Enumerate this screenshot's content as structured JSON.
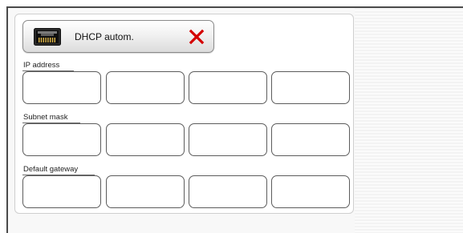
{
  "network": {
    "dhcp_button": {
      "label": "DHCP autom.",
      "icon": "ethernet-port-icon",
      "close_icon": "close-icon",
      "close_color": "#d40000"
    },
    "sections": [
      {
        "label": "IP address",
        "octets": [
          "",
          "",
          "",
          ""
        ]
      },
      {
        "label": "Subnet mask",
        "octets": [
          "",
          "",
          "",
          ""
        ]
      },
      {
        "label": "Default gateway",
        "octets": [
          "",
          "",
          "",
          ""
        ]
      }
    ]
  }
}
